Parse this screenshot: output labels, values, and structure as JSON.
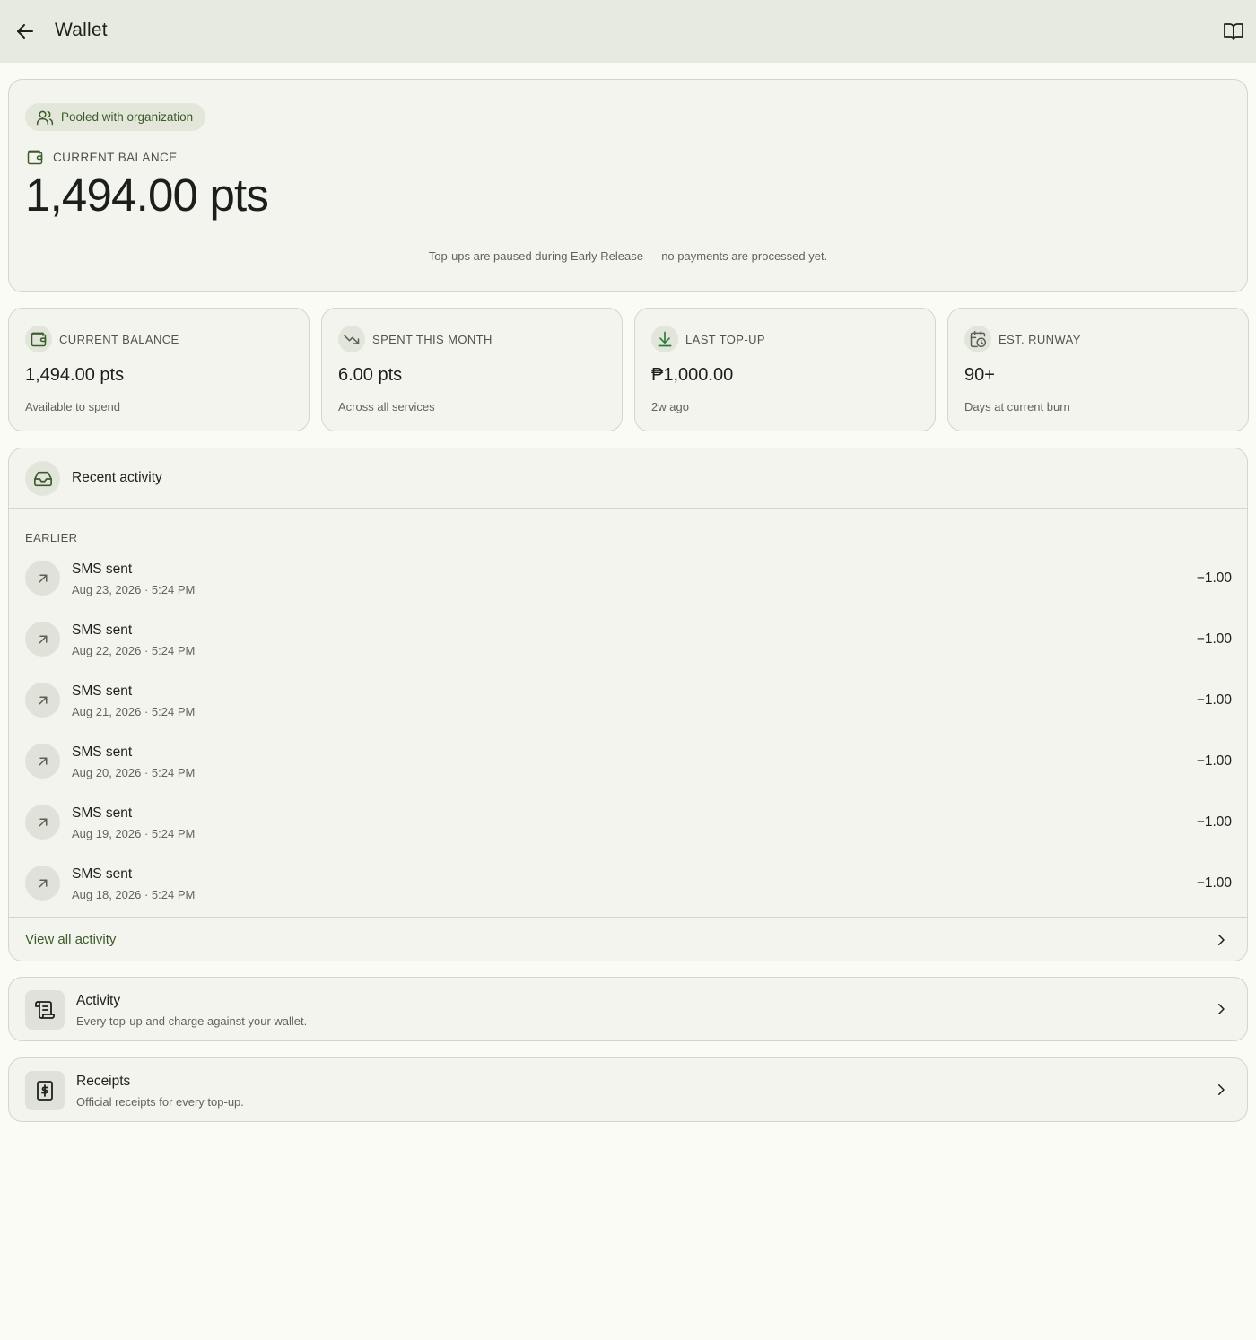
{
  "appbar": {
    "title": "Wallet"
  },
  "hero": {
    "pool_chip": "Pooled with organization",
    "balance_label": "CURRENT BALANCE",
    "balance_value": "1,494.00 pts",
    "notice": "Top-ups are paused during Early Release — no payments are processed yet."
  },
  "stats": [
    {
      "label": "CURRENT BALANCE",
      "value": "1,494.00 pts",
      "sub": "Available to spend",
      "icon": "wallet-icon"
    },
    {
      "label": "SPENT THIS MONTH",
      "value": "6.00 pts",
      "sub": "Across all services",
      "icon": "trending-down-icon"
    },
    {
      "label": "LAST TOP-UP",
      "value": "₱1,000.00",
      "sub": "2w ago",
      "icon": "download-icon"
    },
    {
      "label": "EST. RUNWAY",
      "value": "90+",
      "sub": "Days at current burn",
      "icon": "calendar-clock-icon"
    }
  ],
  "activity": {
    "title": "Recent activity",
    "group_label": "EARLIER",
    "items": [
      {
        "name": "SMS sent",
        "date": "Aug 23, 2026 · 5:24 PM",
        "amount": "−1.00"
      },
      {
        "name": "SMS sent",
        "date": "Aug 22, 2026 · 5:24 PM",
        "amount": "−1.00"
      },
      {
        "name": "SMS sent",
        "date": "Aug 21, 2026 · 5:24 PM",
        "amount": "−1.00"
      },
      {
        "name": "SMS sent",
        "date": "Aug 20, 2026 · 5:24 PM",
        "amount": "−1.00"
      },
      {
        "name": "SMS sent",
        "date": "Aug 19, 2026 · 5:24 PM",
        "amount": "−1.00"
      },
      {
        "name": "SMS sent",
        "date": "Aug 18, 2026 · 5:24 PM",
        "amount": "−1.00"
      }
    ],
    "view_all": "View all activity"
  },
  "nav": [
    {
      "title": "Activity",
      "subtitle": "Every top-up and charge against your wallet.",
      "icon": "scroll-icon"
    },
    {
      "title": "Receipts",
      "subtitle": "Official receipts for every top-up.",
      "icon": "receipt-icon"
    }
  ],
  "colors": {
    "appbar_bg": "#e6eadf",
    "card_bg": "#f3f4ed",
    "accent": "#3d5a2c",
    "page_bg": "#fbfbf6"
  }
}
